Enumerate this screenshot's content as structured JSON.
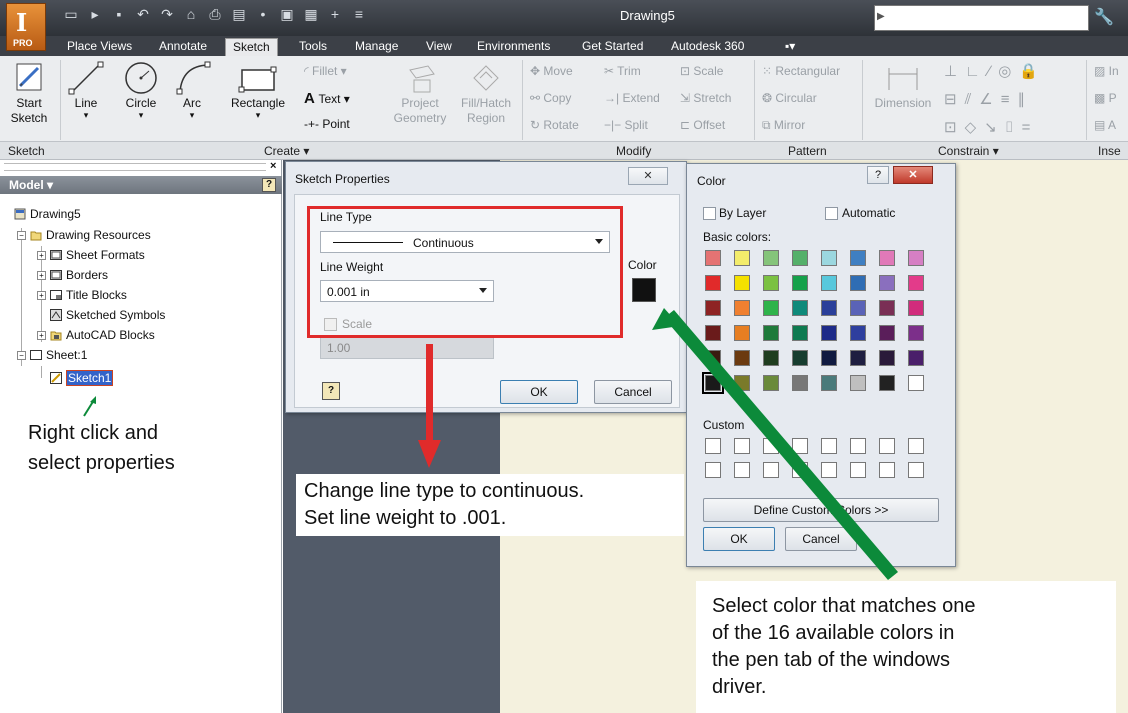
{
  "titlebar": {
    "doc_title": "Drawing5",
    "app_logo": "I",
    "app_badge": "PRO"
  },
  "tabs": [
    "Place Views",
    "Annotate",
    "Sketch",
    "Tools",
    "Manage",
    "View",
    "Environments",
    "Get Started",
    "Autodesk 360"
  ],
  "ribbon": {
    "start_sketch": "Start\nSketch",
    "line": "Line",
    "circle": "Circle",
    "arc": "Arc",
    "rectangle": "Rectangle",
    "fillet": "Fillet ▾",
    "text": "Text ▾",
    "point": "Point",
    "project_geometry": "Project\nGeometry",
    "fill_hatch": "Fill/Hatch\nRegion",
    "move": "Move",
    "trim": "Trim",
    "scale": "Scale",
    "copy": "Copy",
    "extend": "Extend",
    "stretch": "Stretch",
    "rotate": "Rotate",
    "split": "Split",
    "offset": "Offset",
    "rectangular": "Rectangular",
    "circular": "Circular",
    "mirror": "Mirror",
    "dimension": "Dimension",
    "in1": "In",
    "p1": "P",
    "a1": "A"
  },
  "panels": {
    "sketch": "Sketch",
    "create": "Create ▾",
    "modify": "Modify",
    "pattern": "Pattern",
    "constrain": "Constrain ▾",
    "insert": "Inse"
  },
  "model": {
    "header": "Model ▾",
    "tree": {
      "drawing": "Drawing5",
      "resources": "Drawing Resources",
      "sheet_formats": "Sheet Formats",
      "borders": "Borders",
      "title_blocks": "Title Blocks",
      "sketched_symbols": "Sketched Symbols",
      "autocad_blocks": "AutoCAD Blocks",
      "sheet": "Sheet:1",
      "sketch": "Sketch1"
    },
    "note": "Right click and\nselect properties"
  },
  "sketch_props": {
    "title": "Sketch Properties",
    "line_type_label": "Line Type",
    "line_type_value": "Continuous",
    "line_weight_label": "Line Weight",
    "line_weight_value": "0.001 in",
    "scale_label": "Scale",
    "scale_value": "1.00",
    "color_label": "Color",
    "ok": "OK",
    "cancel": "Cancel"
  },
  "color_dialog": {
    "title": "Color",
    "by_layer": "By Layer",
    "automatic": "Automatic",
    "basic_colors": "Basic colors:",
    "custom_colors": "Custom",
    "define_custom": "Define Custom Colors >>",
    "ok": "OK",
    "cancel": "Cancel",
    "basic": [
      [
        "#e57373",
        "#f3ec6b",
        "#85c47a",
        "#55b06a",
        "#9bd7df",
        "#3f7fc2",
        "#e079b8",
        "#d67fc4"
      ],
      [
        "#e12a2a",
        "#f5e100",
        "#7bc142",
        "#16a14b",
        "#58c8dc",
        "#2f6db4",
        "#8a6fbe",
        "#e33b8a"
      ],
      [
        "#8e2323",
        "#f08030",
        "#2fb34a",
        "#0f8a7a",
        "#2a3f99",
        "#5a63b7",
        "#7a2f55",
        "#d12c7c"
      ],
      [
        "#6a1b1b",
        "#e67e22",
        "#1f7a3a",
        "#0e7a50",
        "#1d2a88",
        "#2e3f9e",
        "#5a1e5a",
        "#7c2f8a"
      ],
      [
        "#3a1b10",
        "#6b3a10",
        "#1f3d1f",
        "#173d2f",
        "#101a40",
        "#1e1e40",
        "#2a1a3a",
        "#4a1f6a"
      ],
      [
        "#1a1a1a",
        "#7a7a2a",
        "#6a8a3a",
        "#777777",
        "#4a7a7a",
        "#bfbfbf",
        "#222222",
        "#ffffff"
      ]
    ]
  },
  "callouts": {
    "center": "Change line type to continuous.\nSet line weight to .001.",
    "right": "Select color that matches one\nof the 16 available colors in\nthe pen tab of the windows\ndriver."
  },
  "colors": {
    "highlight_red": "#e02b2b",
    "arrow_green": "#0c8a3a"
  }
}
